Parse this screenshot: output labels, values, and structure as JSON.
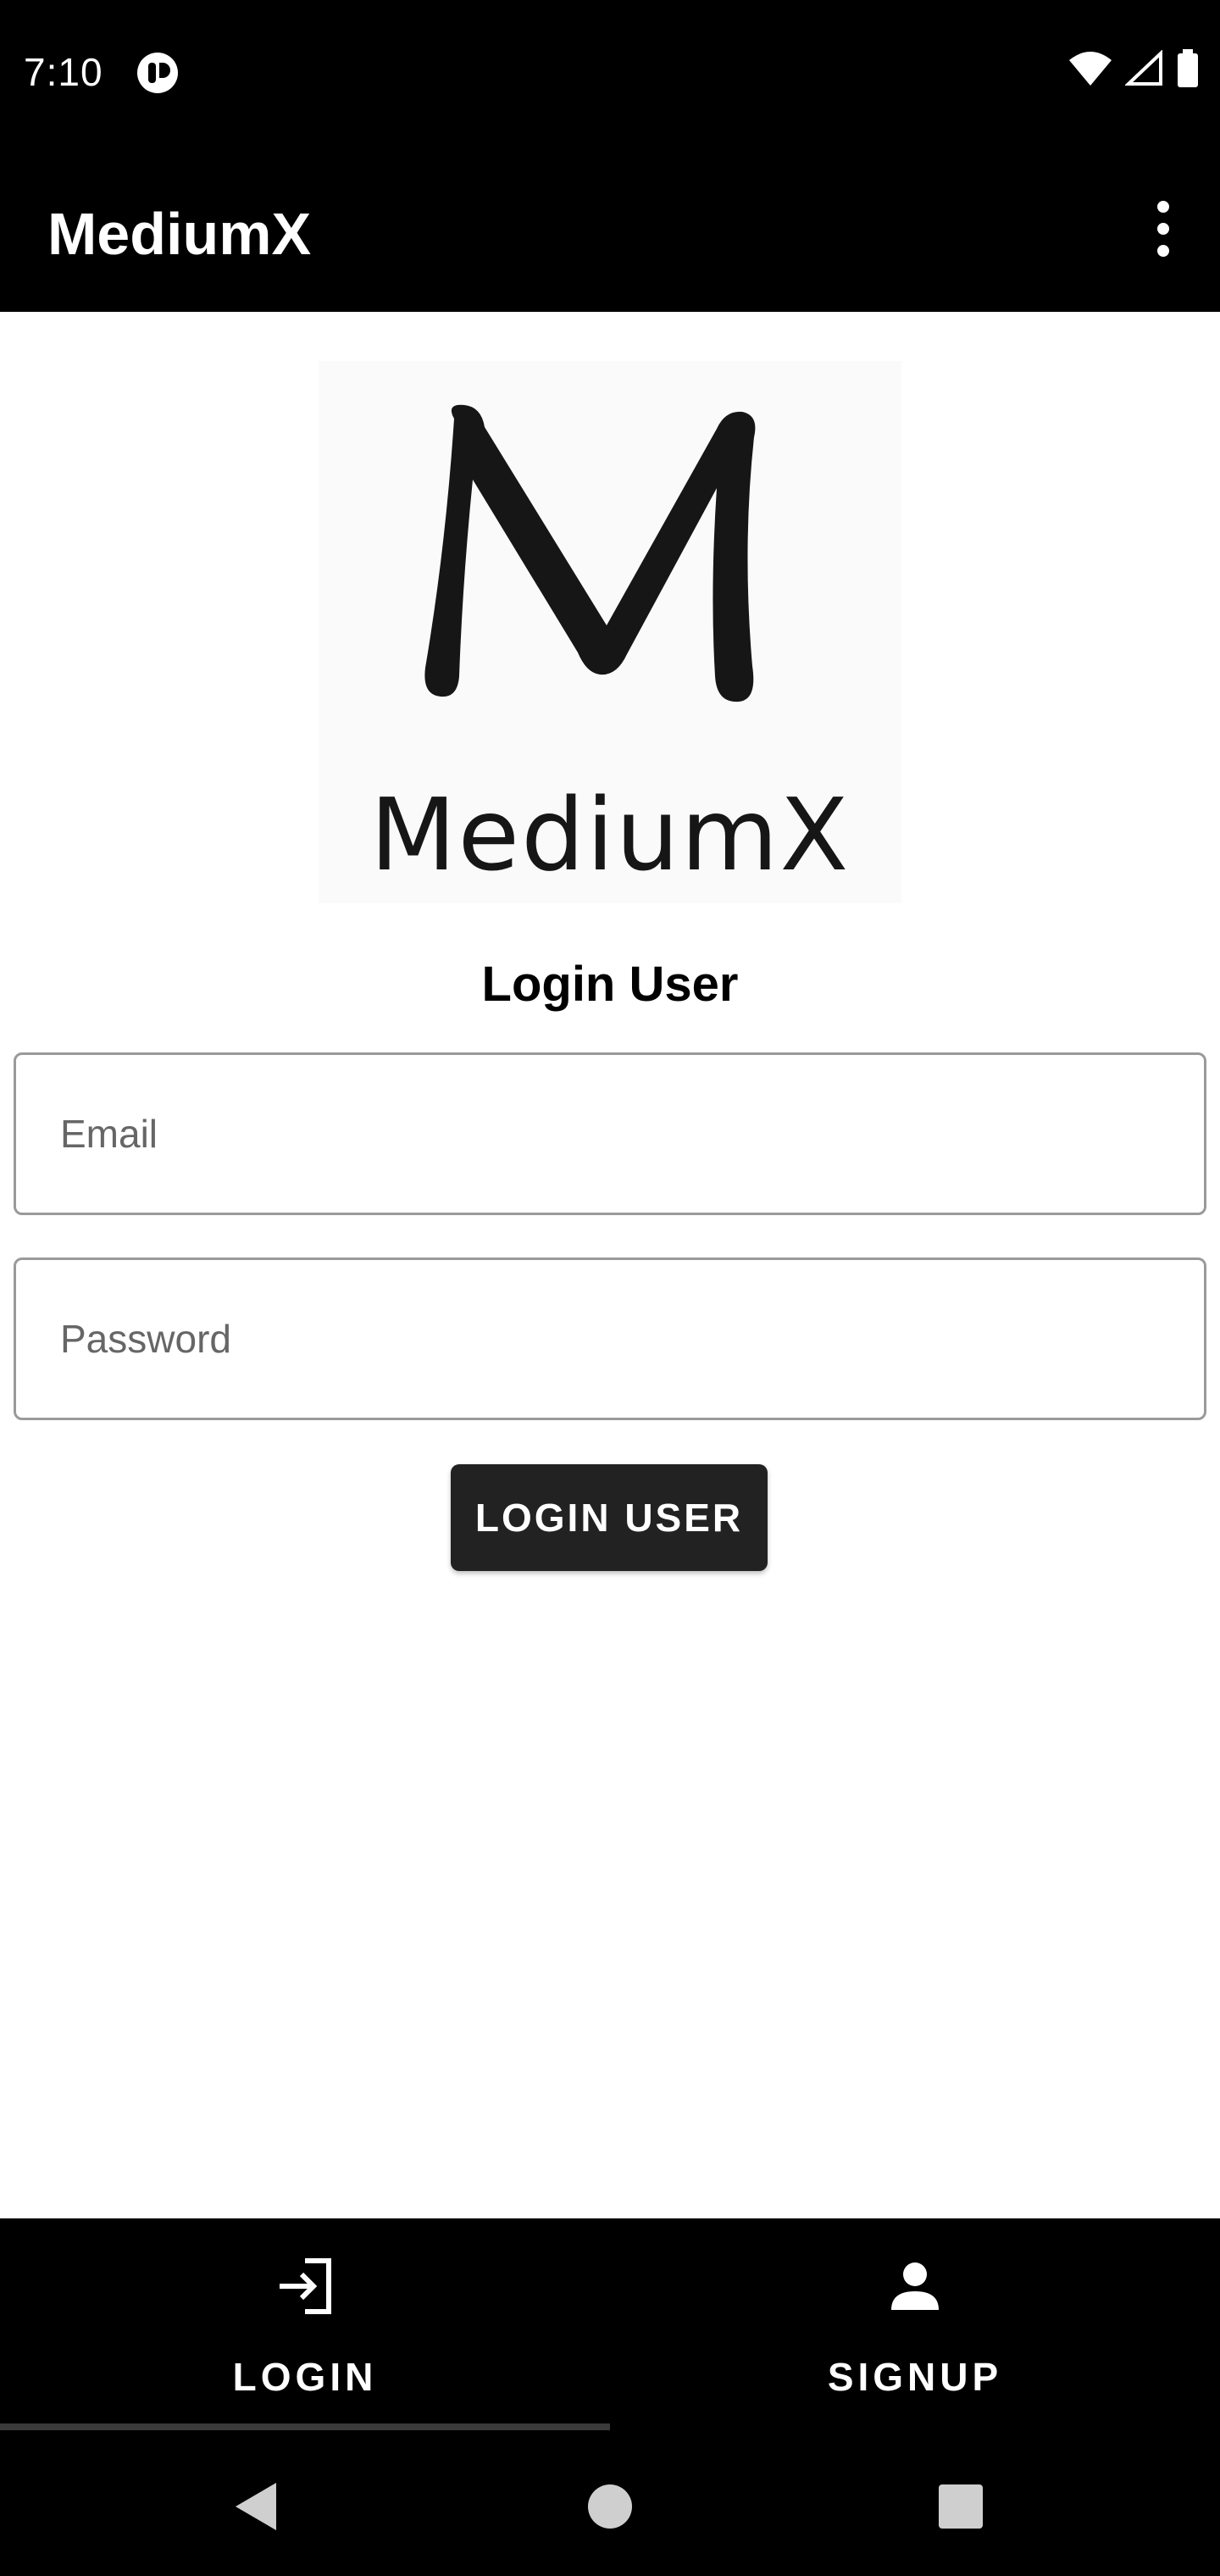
{
  "status_bar": {
    "time": "7:10",
    "icons": [
      "app-notification-icon",
      "wifi-icon",
      "cellular-signal-icon",
      "battery-icon"
    ]
  },
  "app_bar": {
    "title": "MediumX",
    "menu_icon": "overflow-menu-icon"
  },
  "logo": {
    "wordmark": "MediumX"
  },
  "login_form": {
    "title": "Login User",
    "email_placeholder": "Email",
    "email_value": "",
    "password_placeholder": "Password",
    "password_value": "",
    "submit_label": "LOGIN USER"
  },
  "bottom_nav": {
    "items": [
      {
        "label": "LOGIN",
        "icon": "login-icon",
        "selected": true
      },
      {
        "label": "SIGNUP",
        "icon": "person-icon",
        "selected": false
      }
    ]
  },
  "system_nav": {
    "icons": [
      "back-icon",
      "home-icon",
      "recents-icon"
    ]
  },
  "colors": {
    "bar_background": "#000000",
    "button_background": "#222222",
    "field_border": "#9a9a9a",
    "page_background": "#ffffff"
  }
}
